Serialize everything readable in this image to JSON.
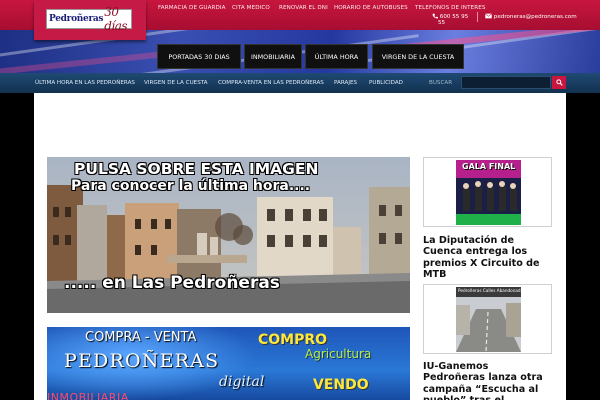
{
  "brand": {
    "logo_word": "Pedroñeras",
    "logo_num": "30 días"
  },
  "top_links": [
    "FARMACIA DE GUARDIA",
    "CITA MEDICO",
    "RENOVAR EL DNI",
    "HORARIO DE AUTOBUSES",
    "TELEFONOS DE INTERES"
  ],
  "contact": {
    "phone_line1": "600 55 95",
    "phone_line2": "55",
    "email": "pedroneras@pedroneras.com"
  },
  "main_nav": [
    "PORTADAS 30 DIAS",
    "INMOBILIARIA",
    "ÚLTIMA HORA",
    "VIRGEN DE LA CUESTA"
  ],
  "sub_nav": [
    "ÚLTIMA HORA EN LAS PEDROÑERAS",
    "VIRGEN DE LA CUESTA",
    "COMPRA-VENTA EN LAS PEDROÑERAS",
    "PARAJES",
    "PUBLICIDAD"
  ],
  "search": {
    "label": "BUSCAR",
    "value": ""
  },
  "banner1": {
    "line1": "PULSA SOBRE ESTA IMAGEN",
    "line2": "Para conocer la última hora....",
    "line3": "..... en Las Pedroñeras"
  },
  "banner2": {
    "line1": "COMPRA - VENTA",
    "line2": "PEDROÑERAS",
    "line3": "digital",
    "line4": "INMOBILIARIA",
    "tag1": "COMPRO",
    "tag2": "Agricultura",
    "tag3": "VENDO"
  },
  "sidebar": [
    {
      "thumb_text": "GALA FINAL",
      "title": "La Diputación de Cuenca entrega los premios X Circuito de MTB"
    },
    {
      "thumb_text": "Pedroñeras Calles Abandonadas",
      "title": "IU-Ganemos Pedroñeras lanza otra campaña “Escucha al pueblo” tras el"
    }
  ],
  "colors": {
    "brand_red": "#c8163f",
    "nav_blue": "#1f4a73"
  }
}
